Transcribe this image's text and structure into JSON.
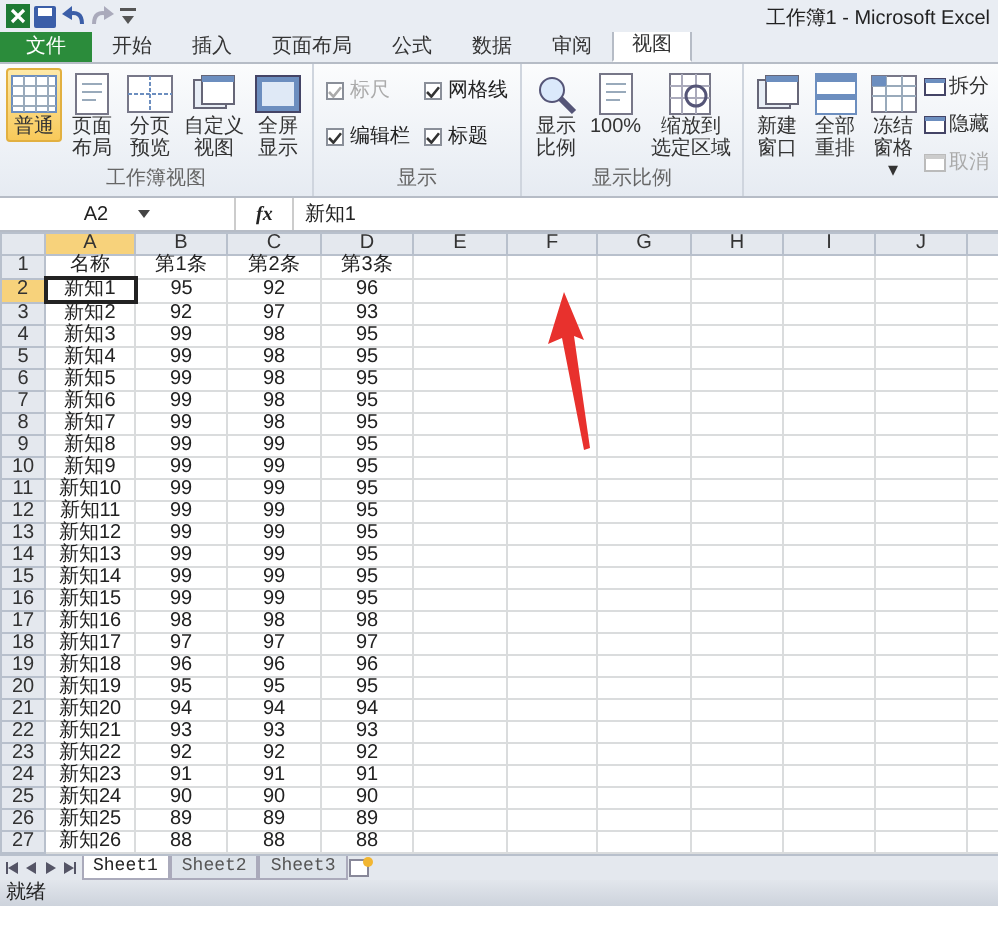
{
  "title_bar": {
    "title": "工作簿1 - Microsoft Excel"
  },
  "ribbon_tabs": [
    {
      "label": "文件",
      "kind": "file",
      "selected": false
    },
    {
      "label": "开始",
      "kind": "tab",
      "selected": false
    },
    {
      "label": "插入",
      "kind": "tab",
      "selected": false
    },
    {
      "label": "页面布局",
      "kind": "tab",
      "selected": false
    },
    {
      "label": "公式",
      "kind": "tab",
      "selected": false
    },
    {
      "label": "数据",
      "kind": "tab",
      "selected": false
    },
    {
      "label": "审阅",
      "kind": "tab",
      "selected": false
    },
    {
      "label": "视图",
      "kind": "tab",
      "selected": true
    }
  ],
  "ribbon_groups": [
    {
      "label": "工作簿视图",
      "items": [
        {
          "kind": "large",
          "lines": [
            "普通"
          ],
          "selected": true
        },
        {
          "kind": "large",
          "lines": [
            "页面",
            "布局"
          ],
          "selected": false
        },
        {
          "kind": "large",
          "lines": [
            "分页",
            "预览"
          ],
          "selected": false
        },
        {
          "kind": "large",
          "lines": [
            "自定义",
            "视图"
          ],
          "selected": false
        },
        {
          "kind": "large",
          "lines": [
            "全屏",
            "显示"
          ],
          "selected": false
        }
      ]
    },
    {
      "label": "显示",
      "items": [
        {
          "kind": "checkbox",
          "label": "标尺",
          "checked": true,
          "disabled": true
        },
        {
          "kind": "checkbox",
          "label": "编辑栏",
          "checked": true,
          "disabled": false
        },
        {
          "kind": "checkbox",
          "label": "网格线",
          "checked": true,
          "disabled": false
        },
        {
          "kind": "checkbox",
          "label": "标题",
          "checked": true,
          "disabled": false
        }
      ]
    },
    {
      "label": "显示比例",
      "items": [
        {
          "kind": "large",
          "lines": [
            "显示",
            "比例"
          ],
          "selected": false
        },
        {
          "kind": "large",
          "lines": [
            "100%"
          ],
          "selected": false
        },
        {
          "kind": "large",
          "lines": [
            "缩放到",
            "选定区域"
          ],
          "selected": false
        }
      ]
    },
    {
      "items": [
        {
          "kind": "large",
          "lines": [
            "新建",
            "窗口"
          ],
          "selected": false
        },
        {
          "kind": "large",
          "lines": [
            "全部",
            "重排"
          ],
          "selected": false
        },
        {
          "kind": "large",
          "lines": [
            "冻结",
            "窗格",
            "▾"
          ],
          "selected": false
        },
        {
          "kind": "small",
          "label": "拆分",
          "disabled": false
        },
        {
          "kind": "small",
          "label": "隐藏",
          "disabled": false
        },
        {
          "kind": "small",
          "label": "取消",
          "disabled": true
        }
      ]
    }
  ],
  "formula_bar": {
    "name_box": "A2",
    "function_label": "fx",
    "formula": "新知1"
  },
  "sheet": {
    "columns": [
      {
        "label": "A",
        "selected": true
      },
      {
        "label": "B",
        "selected": false
      },
      {
        "label": "C",
        "selected": false
      },
      {
        "label": "D",
        "selected": false
      },
      {
        "label": "E",
        "selected": false
      },
      {
        "label": "F",
        "selected": false
      },
      {
        "label": "G",
        "selected": false
      },
      {
        "label": "H",
        "selected": false
      },
      {
        "label": "I",
        "selected": false
      },
      {
        "label": "J",
        "selected": false
      }
    ],
    "rows": [
      {
        "number": "1",
        "selected": false,
        "cells": [
          "名称",
          "第1条",
          "第2条",
          "第3条"
        ]
      },
      {
        "number": "2",
        "selected": true,
        "cells": [
          "新知1",
          "95",
          "92",
          "96"
        ]
      },
      {
        "number": "3",
        "selected": false,
        "cells": [
          "新知2",
          "92",
          "97",
          "93"
        ]
      },
      {
        "number": "4",
        "selected": false,
        "cells": [
          "新知3",
          "99",
          "98",
          "95"
        ]
      },
      {
        "number": "5",
        "selected": false,
        "cells": [
          "新知4",
          "99",
          "98",
          "95"
        ]
      },
      {
        "number": "6",
        "selected": false,
        "cells": [
          "新知5",
          "99",
          "98",
          "95"
        ]
      },
      {
        "number": "7",
        "selected": false,
        "cells": [
          "新知6",
          "99",
          "98",
          "95"
        ]
      },
      {
        "number": "8",
        "selected": false,
        "cells": [
          "新知7",
          "99",
          "98",
          "95"
        ]
      },
      {
        "number": "9",
        "selected": false,
        "cells": [
          "新知8",
          "99",
          "99",
          "95"
        ]
      },
      {
        "number": "10",
        "selected": false,
        "cells": [
          "新知9",
          "99",
          "99",
          "95"
        ]
      },
      {
        "number": "11",
        "selected": false,
        "cells": [
          "新知10",
          "99",
          "99",
          "95"
        ]
      },
      {
        "number": "12",
        "selected": false,
        "cells": [
          "新知11",
          "99",
          "99",
          "95"
        ]
      },
      {
        "number": "13",
        "selected": false,
        "cells": [
          "新知12",
          "99",
          "99",
          "95"
        ]
      },
      {
        "number": "14",
        "selected": false,
        "cells": [
          "新知13",
          "99",
          "99",
          "95"
        ]
      },
      {
        "number": "15",
        "selected": false,
        "cells": [
          "新知14",
          "99",
          "99",
          "95"
        ]
      },
      {
        "number": "16",
        "selected": false,
        "cells": [
          "新知15",
          "99",
          "99",
          "95"
        ]
      },
      {
        "number": "17",
        "selected": false,
        "cells": [
          "新知16",
          "98",
          "98",
          "98"
        ]
      },
      {
        "number": "18",
        "selected": false,
        "cells": [
          "新知17",
          "97",
          "97",
          "97"
        ]
      },
      {
        "number": "19",
        "selected": false,
        "cells": [
          "新知18",
          "96",
          "96",
          "96"
        ]
      },
      {
        "number": "20",
        "selected": false,
        "cells": [
          "新知19",
          "95",
          "95",
          "95"
        ]
      },
      {
        "number": "21",
        "selected": false,
        "cells": [
          "新知20",
          "94",
          "94",
          "94"
        ]
      },
      {
        "number": "22",
        "selected": false,
        "cells": [
          "新知21",
          "93",
          "93",
          "93"
        ]
      },
      {
        "number": "23",
        "selected": false,
        "cells": [
          "新知22",
          "92",
          "92",
          "92"
        ]
      },
      {
        "number": "24",
        "selected": false,
        "cells": [
          "新知23",
          "91",
          "91",
          "91"
        ]
      },
      {
        "number": "25",
        "selected": false,
        "cells": [
          "新知24",
          "90",
          "90",
          "90"
        ]
      },
      {
        "number": "26",
        "selected": false,
        "cells": [
          "新知25",
          "89",
          "89",
          "89"
        ]
      },
      {
        "number": "27",
        "selected": false,
        "cells": [
          "新知26",
          "88",
          "88",
          "88"
        ]
      }
    ]
  },
  "sheet_tabs": [
    {
      "label": "Sheet1",
      "selected": true
    },
    {
      "label": "Sheet2",
      "selected": false
    },
    {
      "label": "Sheet3",
      "selected": false
    }
  ],
  "status_bar": {
    "text": "就绪"
  }
}
